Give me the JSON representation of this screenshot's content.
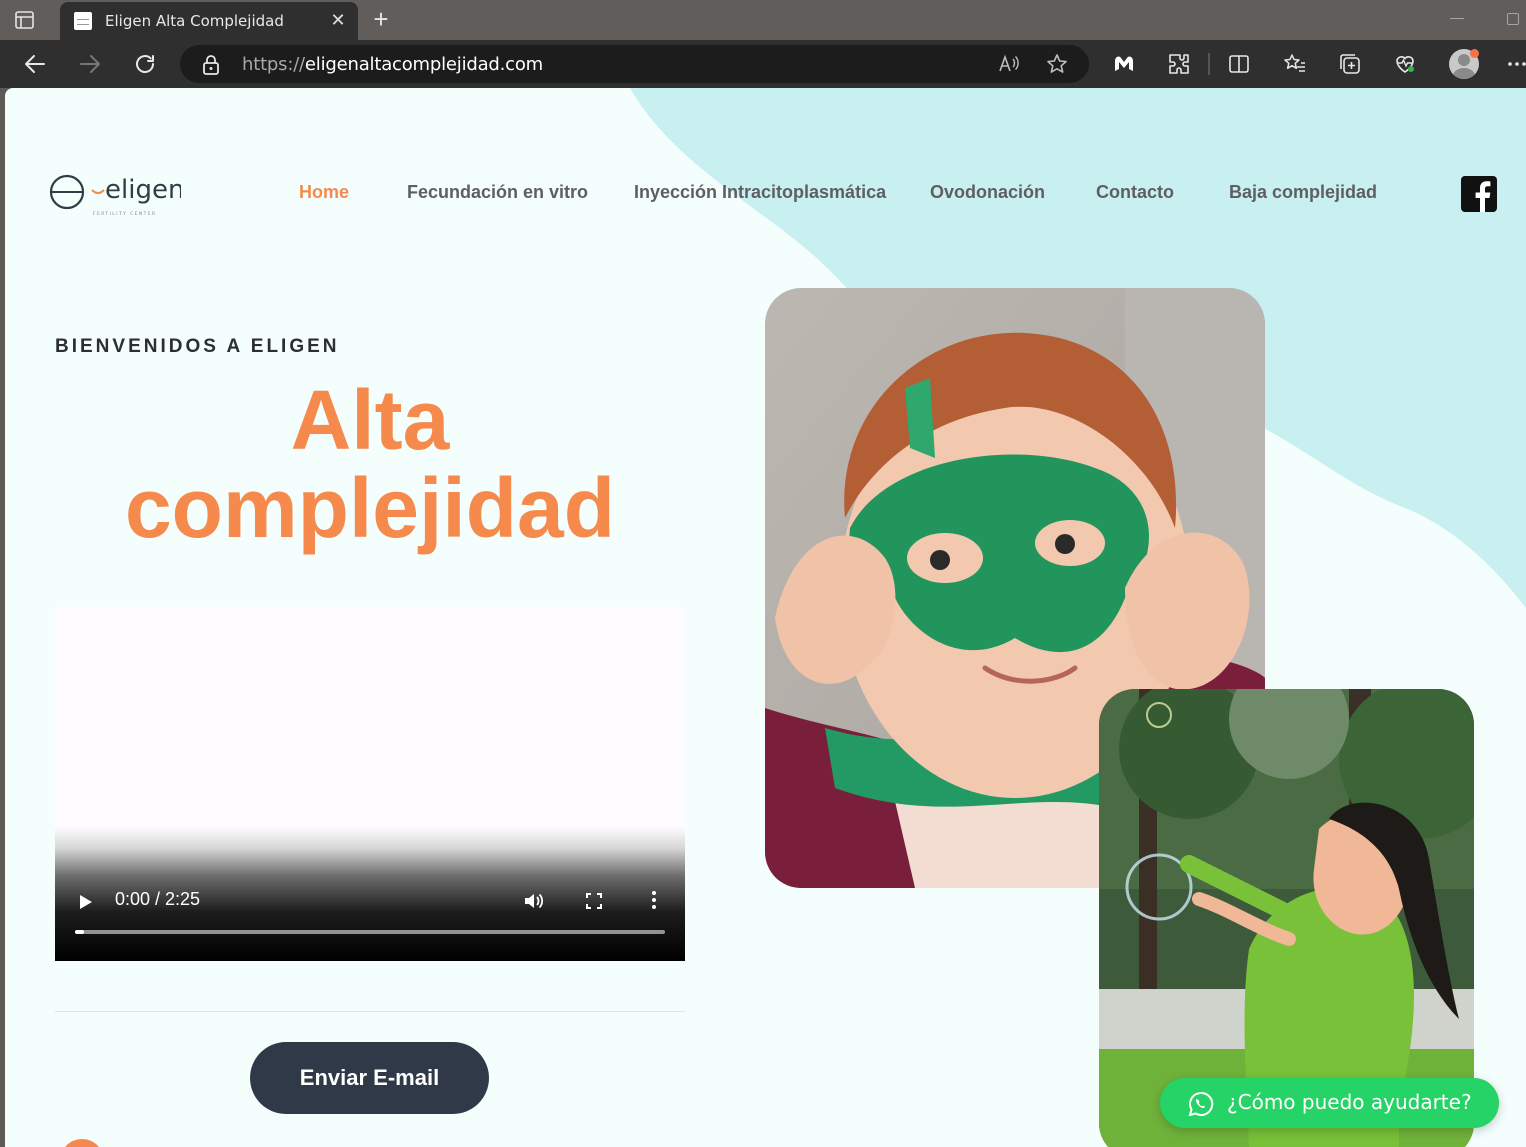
{
  "browser": {
    "tab_title": "Eligen Alta Complejidad",
    "tab_close": "✕",
    "new_tab": "+",
    "url_scheme": "https://",
    "url_host": "eligenaltacomplejidad.com",
    "icons": [
      "sidebar-toggle-icon",
      "back-icon",
      "forward-icon",
      "refresh-icon",
      "lock-icon",
      "read-aloud-icon",
      "favorite-star-icon",
      "malwarebytes-icon",
      "extensions-icon",
      "split-screen-icon",
      "favorites-icon",
      "collections-icon",
      "browser-essentials-icon",
      "profile-avatar",
      "more-icon"
    ]
  },
  "site": {
    "logo_text": "eligen",
    "logo_sub": "FERTILITY CENTER",
    "nav": [
      {
        "label": "Home",
        "active": true
      },
      {
        "label": "Fecundación en vitro"
      },
      {
        "label": "Inyección Intracitoplasmática"
      },
      {
        "label": "Ovodonación"
      },
      {
        "label": "Contacto"
      },
      {
        "label": "Baja complejidad"
      }
    ],
    "social_icon": "facebook-icon",
    "eyebrow": "BIENVENIDOS A ELIGEN",
    "hero_line1": "Alta",
    "hero_line2": "complejidad",
    "video": {
      "time": "0:00 / 2:25",
      "progress": 0.0
    },
    "email_button": "Enviar E-mail",
    "whatsapp_button": "¿Cómo puedo ayudarte?",
    "colors": {
      "accent": "#f58a4c",
      "dark_button": "#303947",
      "whatsapp": "#25d366",
      "blob": "#c9f0f0",
      "bg": "#f4fefd"
    }
  }
}
